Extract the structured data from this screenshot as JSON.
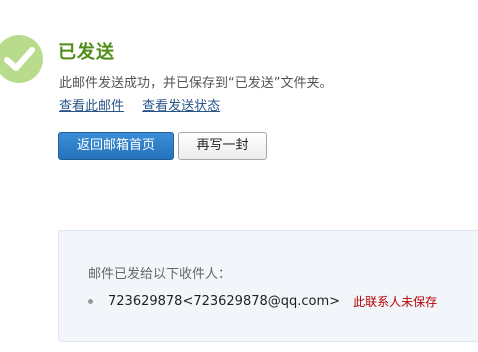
{
  "status": {
    "title": "已发送",
    "description": "此邮件发送成功，并已保存到“已发送”文件夹。"
  },
  "links": {
    "view_mail": "查看此邮件",
    "view_status": "查看发送状态"
  },
  "buttons": {
    "back_to_inbox": "返回邮箱首页",
    "write_another": "再写一封"
  },
  "recipients": {
    "heading": "邮件已发给以下收件人：",
    "items": [
      {
        "address": "723629878<723629878@qq.com>",
        "note": "此联系人未保存"
      }
    ]
  },
  "colors": {
    "success_green": "#4f8d17",
    "icon_green": "#b8dc8c",
    "link_blue": "#2a5589",
    "primary_button": "#2a7cc7",
    "warning_red": "#b30000",
    "panel_bg": "#f2f6fb"
  },
  "icons": {
    "success": "check-circle-icon"
  }
}
